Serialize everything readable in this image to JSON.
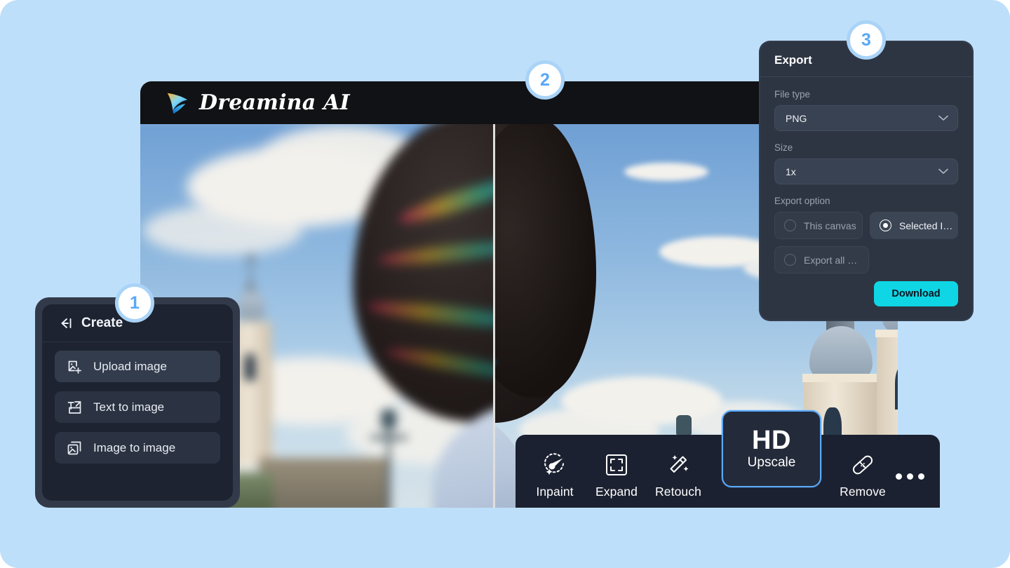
{
  "theme": {
    "page_background": "#bedffa",
    "panel_background": "#2e3542",
    "accent_blue": "#58a9f5",
    "download_cyan": "#0fd6e4",
    "upscale_border": "#5aa9f8"
  },
  "editor": {
    "brand_name": "Dreamina AI",
    "logo_icon": "spark-star-icon",
    "comparison": {
      "divider": true
    }
  },
  "create_panel": {
    "badge": "1",
    "collapse_icon": "collapse-left-icon",
    "title": "Create",
    "items": [
      {
        "label": "Upload image",
        "icon": "upload-image-icon"
      },
      {
        "label": "Text to image",
        "icon": "text-to-image-icon"
      },
      {
        "label": "Image to image",
        "icon": "image-to-image-icon"
      }
    ]
  },
  "toolbar": {
    "badge": "2",
    "tools": [
      {
        "label": "Inpaint",
        "icon": "inpaint-brush-icon"
      },
      {
        "label": "Expand",
        "icon": "expand-frame-icon"
      },
      {
        "label": "Retouch",
        "icon": "retouch-wand-icon"
      },
      {
        "label": "Remove",
        "icon": "remove-bandage-icon"
      }
    ],
    "upscale": {
      "title": "HD",
      "label": "Upscale",
      "selected": true
    },
    "more_icon": "more-ellipsis-icon"
  },
  "export_panel": {
    "badge": "3",
    "title": "Export",
    "file_type": {
      "label": "File type",
      "value": "PNG",
      "chevron": "chevron-down-icon"
    },
    "size": {
      "label": "Size",
      "value": "1x",
      "chevron": "chevron-down-icon"
    },
    "export_option": {
      "label": "Export option",
      "options": [
        {
          "label": "This canvas",
          "selected": false
        },
        {
          "label": "Selected I…",
          "selected": true
        },
        {
          "label": "Export all …",
          "selected": false
        }
      ]
    },
    "download_label": "Download"
  }
}
